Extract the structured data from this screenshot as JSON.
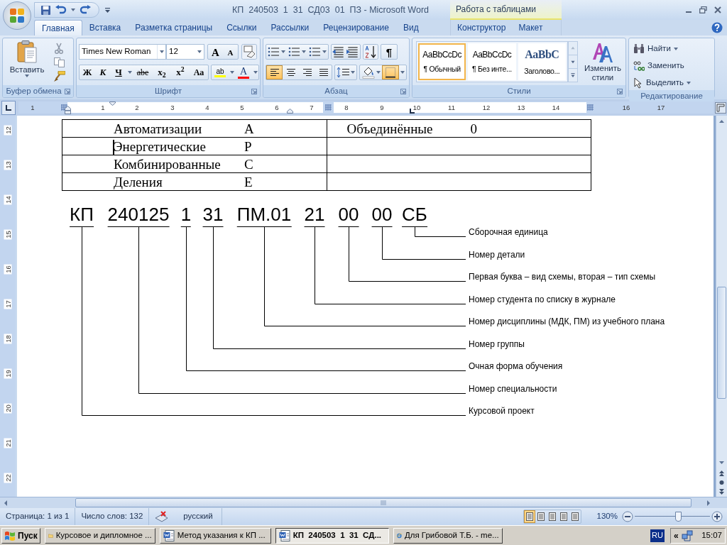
{
  "title_bar": {
    "title": "КП  240503  1  31  СД03  01  ПЗ - Microsoft Word"
  },
  "tabs": [
    {
      "label": "Главная",
      "selected": true
    },
    {
      "label": "Вставка",
      "selected": false
    },
    {
      "label": "Разметка страницы",
      "selected": false
    },
    {
      "label": "Ссылки",
      "selected": false
    },
    {
      "label": "Рассылки",
      "selected": false
    },
    {
      "label": "Рецензирование",
      "selected": false
    },
    {
      "label": "Вид",
      "selected": false
    }
  ],
  "contextual_tabs": {
    "title": "Работа с таблицами",
    "tabs": [
      {
        "label": "Конструктор",
        "selected": false
      },
      {
        "label": "Макет",
        "selected": false
      }
    ]
  },
  "ribbon": {
    "clipboard": {
      "title": "Буфер обмена",
      "paste_label": "Вставить"
    },
    "font": {
      "title": "Шрифт",
      "font_name": "Times New Roman",
      "font_size": "12",
      "size_buttons": [
        "A",
        "A"
      ],
      "format_buttons": [
        {
          "label": "Ж",
          "kind": "bold"
        },
        {
          "label": "К",
          "kind": "italic"
        },
        {
          "label": "Ч",
          "kind": "underline"
        },
        {
          "label": "abe",
          "kind": "strike"
        },
        {
          "label": "x$_{2}$",
          "kind": "plain"
        },
        {
          "label": "x$^{2}$",
          "kind": "plain"
        },
        {
          "label": "Aa",
          "kind": "case"
        }
      ],
      "highlight_label": "ab",
      "color_label": "A"
    },
    "paragraph": {
      "title": "Абзац",
      "pilcrow": "¶",
      "alignment_buttons": [
        {
          "selected": true
        },
        {
          "selected": false
        },
        {
          "selected": false
        },
        {
          "selected": false
        }
      ],
      "borders_selected": true
    },
    "styles": {
      "title": "Стили",
      "gallery": [
        {
          "preview": "AaBbCcDc",
          "name": "¶ Обычный",
          "kind": "normal",
          "selected": true
        },
        {
          "preview": "AaBbCcDc",
          "name": "¶ Без инте...",
          "kind": "normal",
          "selected": false
        },
        {
          "preview": "AaBbC",
          "name": "Заголово...",
          "kind": "heading",
          "selected": false
        }
      ],
      "change_styles_label": "Изменить стили"
    },
    "editing": {
      "title": "Редактирование",
      "buttons": [
        {
          "label": "Найти",
          "kind": "find"
        },
        {
          "label": "Заменить",
          "kind": "replace"
        },
        {
          "label": "Выделить",
          "kind": "select"
        }
      ]
    }
  },
  "horizontal_ruler": [
    "1",
    "1",
    "2",
    "3",
    "4",
    "5",
    "6",
    "7",
    "8",
    "9",
    "10",
    "11",
    "12",
    "13",
    "14",
    "16",
    "17"
  ],
  "vertical_ruler": [
    "12",
    "13",
    "14",
    "15",
    "16",
    "17",
    "18",
    "19",
    "20",
    "21",
    "22"
  ],
  "document": {
    "table": {
      "rows": [
        {
          "cells": [
            {
              "name": "Автоматизации",
              "code": "А"
            },
            {
              "name": "Объединённые",
              "code": "0"
            }
          ]
        },
        {
          "cells": [
            {
              "name": "Энергетические",
              "code": "Р",
              "caret": true
            }
          ]
        },
        {
          "cells": [
            {
              "name": "Комбинированные",
              "code": "С"
            }
          ]
        },
        {
          "cells": [
            {
              "name": "Деления",
              "code": "Е"
            }
          ]
        }
      ]
    },
    "designation": {
      "parts": [
        "КП",
        "240125",
        "1",
        "31",
        "ПМ.01",
        "21",
        "00",
        "00",
        "СБ"
      ],
      "labels": [
        "Сборочная единица",
        "Номер детали",
        "Первая буква – вид схемы, вторая – тип схемы",
        "Номер студента по списку в журнале",
        "Номер дисциплины (МДК, ПМ) из учебного плана",
        "Номер группы",
        "Очная форма обучения",
        "Номер специальности",
        "Курсовой проект"
      ]
    }
  },
  "status_bar": {
    "page": "Страница: 1 из 1",
    "words": "Число слов: 132",
    "language": "русский",
    "view_buttons": [
      {
        "selected": true
      },
      {
        "selected": false
      },
      {
        "selected": false
      },
      {
        "selected": false
      },
      {
        "selected": false
      }
    ],
    "zoom": "130%",
    "zoom_slider": {
      "level": 0.58
    }
  },
  "taskbar": {
    "start": "Пуск",
    "tasks": [
      {
        "label": "Курсовое и дипломное ...",
        "kind": "folder",
        "selected": false
      },
      {
        "label": "Метод указания к КП ...",
        "kind": "word",
        "selected": false
      },
      {
        "label": "КП  240503  1  31  СД...",
        "kind": "word",
        "selected": true
      },
      {
        "label": "Для Грибовой Т.Б. - me...",
        "kind": "browser",
        "selected": false
      }
    ],
    "language": "RU",
    "tray_toggle": "«",
    "clock": "15:07"
  }
}
